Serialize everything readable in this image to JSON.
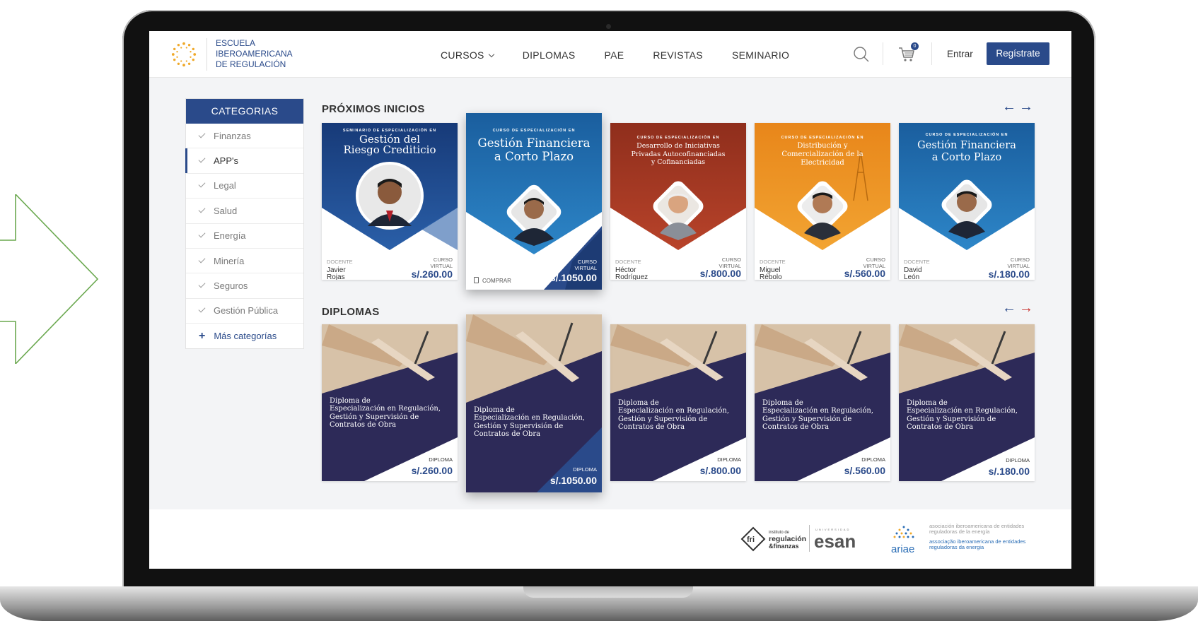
{
  "header": {
    "logo_lines": [
      "ESCUELA",
      "IBEROAMERICANA",
      "DE REGULACIÓN"
    ],
    "nav": [
      "CURSOS",
      "DIPLOMAS",
      "PAE",
      "REVISTAS",
      "SEMINARIO"
    ],
    "cart_count": "0",
    "login_label": "Entrar",
    "register_label": "Regístrate"
  },
  "sidebar": {
    "title": "CATEGORIAS",
    "items": [
      "Finanzas",
      "APP's",
      "Legal",
      "Salud",
      "Energía",
      "Minería",
      "Seguros",
      "Gestión Pública"
    ],
    "active_item": "APP's",
    "more_label": "Más categorías"
  },
  "upcoming": {
    "title": "PRÓXIMOS INICIOS",
    "cards": [
      {
        "tag": "SEMINARIO DE ESPECIALIZACIÓN EN",
        "title": [
          "Gestión del",
          "Riesgo Crediticio"
        ],
        "doc_label": "DOCENTE",
        "docente": [
          "Javier",
          "Rojas"
        ],
        "mode": [
          "CURSO",
          "VIRTUAL"
        ],
        "price": "s/.260.00",
        "color": "#1f4a8f"
      },
      {
        "tag": "CURSO DE ESPECIALIZACIÓN EN",
        "title": [
          "Gestión Financiera",
          "a Corto Plazo"
        ],
        "buy_label": "COMPRAR",
        "mode": [
          "CURSO",
          "VIRTUAL"
        ],
        "price": "s/.1050.00",
        "color": "#1f6fb0"
      },
      {
        "tag": "CURSO DE ESPECIALIZACIÓN EN",
        "title": [
          "Desarrollo de Iniciativas",
          "Privadas Autocofinanciadas",
          "y Cofinanciadas"
        ],
        "doc_label": "DOCENTE",
        "docente": [
          "Héctor",
          "Rodríguez"
        ],
        "mode": [
          "CURSO",
          "VIRTUAL"
        ],
        "price": "s/.800.00",
        "color": "#a83a24"
      },
      {
        "tag": "CURSO DE ESPECIALIZACIÓN EN",
        "title": [
          "Distribución y",
          "Comercialización de la",
          "Electricidad"
        ],
        "doc_label": "DOCENTE",
        "docente": [
          "Miguel",
          "Rébolo"
        ],
        "mode": [
          "CURSO",
          "VIRTUAL"
        ],
        "price": "s/.560.00",
        "color": "#e8901c"
      },
      {
        "tag": "CURSO DE ESPECIALIZACIÓN EN",
        "title": [
          "Gestión Financiera",
          "a Corto Plazo"
        ],
        "doc_label": "DOCENTE",
        "docente": [
          "David",
          "León"
        ],
        "mode": [
          "CURSO",
          "VIRTUAL"
        ],
        "price": "s/.180.00",
        "color": "#1f6fb0"
      }
    ]
  },
  "diplomas": {
    "title": "DIPLOMAS",
    "cards": [
      {
        "title": [
          "Diploma de",
          "Especialización en Regulación,",
          "Gestión y Supervisión de",
          "Contratos de Obra"
        ],
        "label": "DIPLOMA",
        "price": "s/.260.00"
      },
      {
        "title": [
          "Diploma de",
          "Especialización en Regulación,",
          "Gestión y Supervisión de",
          "Contratos de Obra"
        ],
        "label": "DIPLOMA",
        "price": "s/.1050.00"
      },
      {
        "title": [
          "Diploma de",
          "Especialización en Regulación,",
          "Gestión y Supervisión de",
          "Contratos de Obra"
        ],
        "label": "DIPLOMA",
        "price": "s/.800.00"
      },
      {
        "title": [
          "Diploma de",
          "Especialización en Regulación,",
          "Gestión y Supervisión de",
          "Contratos de Obra"
        ],
        "label": "DIPLOMA",
        "price": "s/.560.00"
      },
      {
        "title": [
          "Diploma de",
          "Especialización en Regulación,",
          "Gestión y Supervisión de",
          "Contratos de Obra"
        ],
        "label": "DIPLOMA",
        "price": "s/.180.00"
      }
    ]
  },
  "footer": {
    "fri_lines": [
      "instituto de",
      "regulación",
      "&finanzas"
    ],
    "fri_mark": "fri",
    "esan_top": "UNIVERSIDAD",
    "esan": "esan",
    "ariae": "ariae",
    "ariae_es": "asociación iberoamericana de entidades reguladoras de la energía",
    "ariae_pt": "associação iberoamericana de entidades reguladoras da energia"
  },
  "colors": {
    "brand": "#2a4a8a",
    "accent_red": "#c9302c",
    "deco_arrow": "#6aa84f"
  }
}
